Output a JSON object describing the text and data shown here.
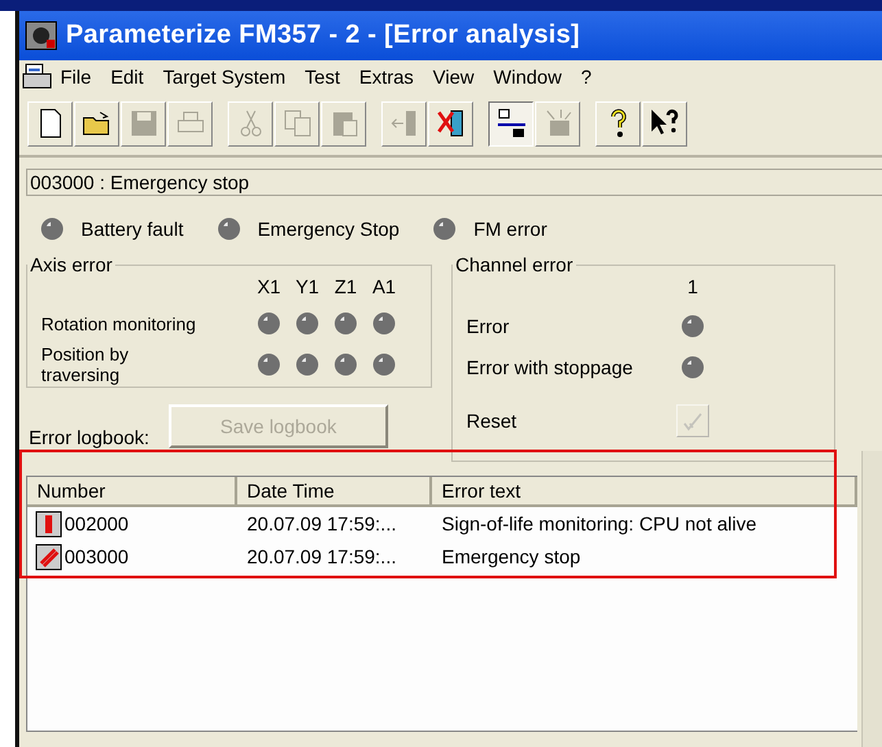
{
  "window": {
    "title": "Parameterize FM357 - 2 - [Error analysis]"
  },
  "menu": [
    "File",
    "Edit",
    "Target System",
    "Test",
    "Extras",
    "View",
    "Window",
    "?"
  ],
  "toolbar": [
    {
      "kind": "new",
      "disabled": false,
      "pressed": false
    },
    {
      "kind": "open",
      "disabled": false,
      "pressed": false
    },
    {
      "kind": "save",
      "disabled": true,
      "pressed": false
    },
    {
      "kind": "print",
      "disabled": true,
      "pressed": false
    },
    {
      "kind": "cut",
      "disabled": true,
      "pressed": false
    },
    {
      "kind": "copy",
      "disabled": true,
      "pressed": false
    },
    {
      "kind": "paste",
      "disabled": true,
      "pressed": false
    },
    {
      "kind": "upload",
      "disabled": true,
      "pressed": false
    },
    {
      "kind": "download",
      "disabled": false,
      "pressed": false
    },
    {
      "kind": "network",
      "disabled": false,
      "pressed": true
    },
    {
      "kind": "flash",
      "disabled": true,
      "pressed": false
    },
    {
      "kind": "help",
      "disabled": false,
      "pressed": false
    },
    {
      "kind": "context-help",
      "disabled": false,
      "pressed": false
    }
  ],
  "current_error": "003000 : Emergency stop",
  "indicators": [
    {
      "label": "Battery fault",
      "on": false
    },
    {
      "label": "Emergency Stop",
      "on": false
    },
    {
      "label": "FM error",
      "on": false
    }
  ],
  "axis_error": {
    "title": "Axis error",
    "axes": [
      "X1",
      "Y1",
      "Z1",
      "A1"
    ],
    "rows": [
      {
        "label": "Rotation monitoring",
        "lamps": [
          false,
          false,
          false,
          false
        ]
      },
      {
        "label": "Position by traversing",
        "lamps": [
          false,
          false,
          false,
          false
        ]
      }
    ]
  },
  "channel_error": {
    "title": "Channel error",
    "channel": "1",
    "rows": [
      {
        "label": "Error",
        "on": false
      },
      {
        "label": "Error with stoppage",
        "on": false
      }
    ],
    "reset": {
      "label": "Reset",
      "disabled": true
    }
  },
  "logbook": {
    "label": "Error logbook:",
    "save_button": {
      "label": "Save logbook",
      "disabled": true
    }
  },
  "table": {
    "columns": [
      "Number",
      "Date Time",
      "Error text"
    ],
    "rows": [
      {
        "kind": "bar",
        "number": "002000",
        "datetime": "20.07.09 17:59:...",
        "text": "Sign-of-life monitoring: CPU not alive"
      },
      {
        "kind": "slash",
        "number": "003000",
        "datetime": "20.07.09 17:59:...",
        "text": "Emergency stop"
      }
    ]
  }
}
